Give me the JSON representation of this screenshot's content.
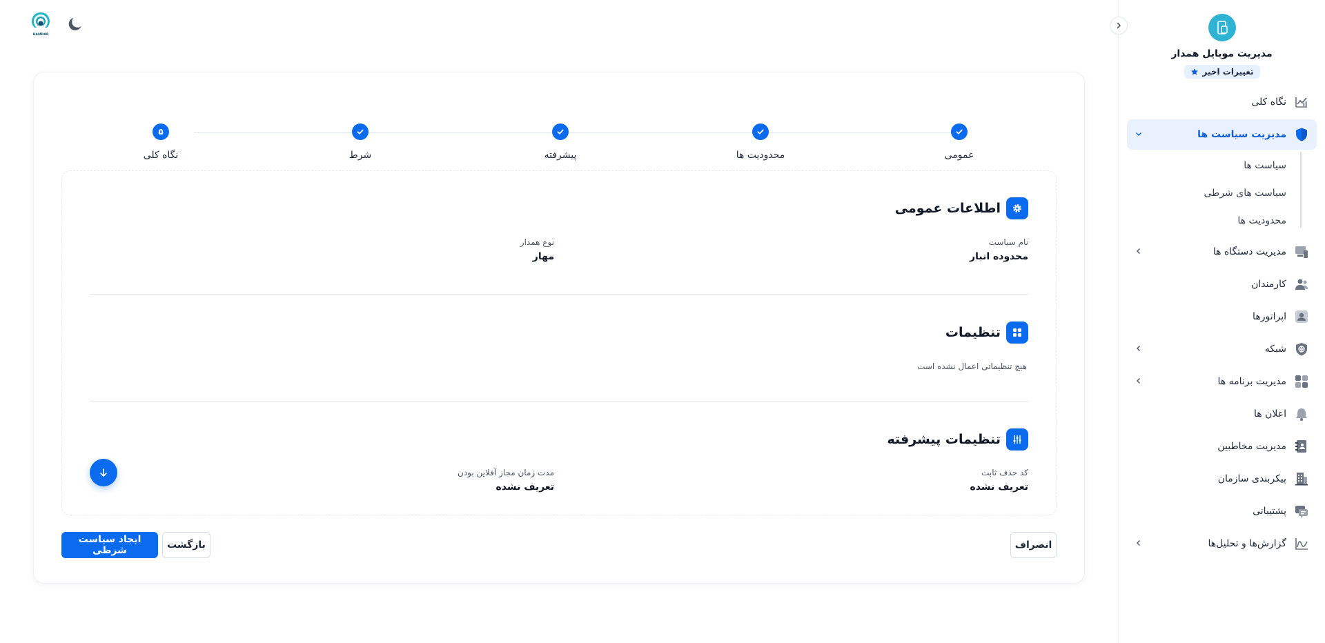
{
  "sidebar": {
    "brand_title": "مدیریت موبایل همدار",
    "changes_badge": "تغییرات اخیر",
    "items": [
      {
        "label": "نگاه کلی",
        "icon": "chart-line-icon"
      },
      {
        "label": "مدیریت سیاست ها",
        "icon": "shield-icon",
        "active": true
      },
      {
        "label": "مدیریت دستگاه ها",
        "icon": "devices-icon"
      },
      {
        "label": "کارمندان",
        "icon": "users-icon"
      },
      {
        "label": "اپراتورها",
        "icon": "user-badge-icon"
      },
      {
        "label": "شبکه",
        "icon": "globe-icon"
      },
      {
        "label": "مدیریت برنامه ها",
        "icon": "apps-grid-icon"
      },
      {
        "label": "اعلان ها",
        "icon": "bell-icon"
      },
      {
        "label": "مدیریت مخاطبین",
        "icon": "contacts-book-icon"
      },
      {
        "label": "پیکربندی سازمان",
        "icon": "building-icon"
      },
      {
        "label": "پشتیبانی",
        "icon": "support-chat-icon"
      },
      {
        "label": "گزارش‌ها و تحلیل‌ها",
        "icon": "analytics-icon"
      }
    ],
    "sub_items": [
      "سیاست ها",
      "سیاست های شرطی",
      "محدودیت ها"
    ]
  },
  "logo_text": "HAMDAR",
  "stepper": {
    "steps": [
      {
        "label": "عمومی",
        "state": "done"
      },
      {
        "label": "محدودیت ها",
        "state": "done"
      },
      {
        "label": "پیشرفته",
        "state": "done"
      },
      {
        "label": "شرط",
        "state": "done"
      },
      {
        "label": "نگاه کلی",
        "state": "current",
        "number": "۵"
      }
    ]
  },
  "general": {
    "title": "اطلاعات عمومی",
    "policy_name_label": "نام سیاست",
    "policy_name_value": "محدوده انبار",
    "hamdar_type_label": "نوع همدار",
    "hamdar_type_value": "مهار"
  },
  "settings": {
    "title": "تنظیمات",
    "empty_note": "هیچ تنظیماتی اعمال نشده است"
  },
  "advanced": {
    "title": "تنظیمات پیشرفته",
    "delete_code_label": "کد حذف ثابت",
    "delete_code_value": "تعریف نشده",
    "offline_label": "مدت زمان مجاز آفلاین بودن",
    "offline_value": "تعریف نشده"
  },
  "actions": {
    "create": "ایجاد سیاست شرطی",
    "back": "بازگشت",
    "cancel": "انصراف"
  },
  "colors": {
    "accent": "#0b6bef",
    "active_bg": "#e8f1fd",
    "brand_teal": "#2fb3d3"
  }
}
